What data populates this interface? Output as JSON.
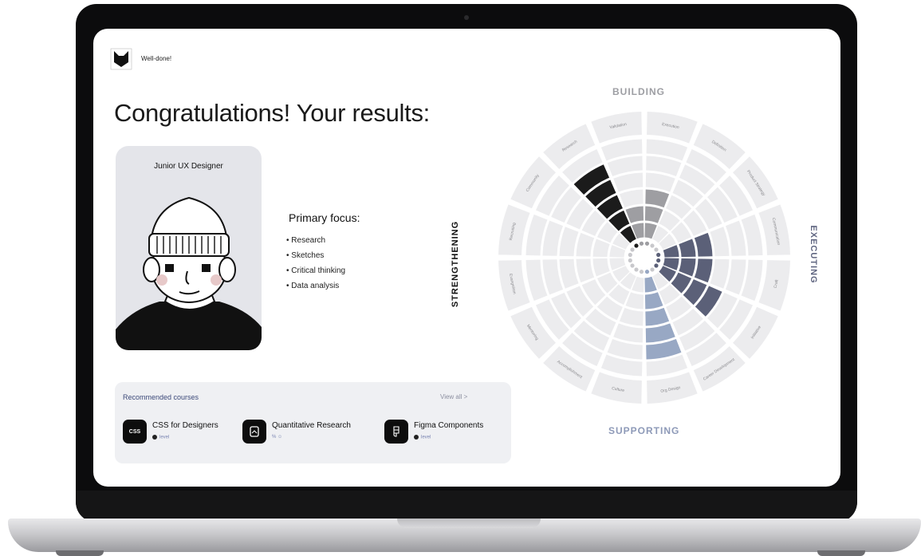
{
  "header": {
    "brand": "Well-done!"
  },
  "page": {
    "title": "Congratulations! Your results:"
  },
  "profile": {
    "role": "Junior UX Designer"
  },
  "focus": {
    "title": "Primary focus:",
    "items": [
      "Research",
      "Sketches",
      "Critical thinking",
      "Data analysis"
    ]
  },
  "courses": {
    "title": "Recommended courses",
    "view_all": "View all >",
    "items": [
      {
        "name": "CSS for Designers",
        "icon": "css-icon",
        "icon_text": "CSS",
        "meta": "level"
      },
      {
        "name": "Quantitative Research",
        "icon": "document-icon",
        "icon_text": "",
        "meta": "% ☺"
      },
      {
        "name": "Figma Components",
        "icon": "figma-icon",
        "icon_text": "",
        "meta": "level"
      }
    ]
  },
  "wheel": {
    "quadrants": {
      "top": "BUILDING",
      "right": "EXECUTING",
      "bottom": "SUPPORTING",
      "left": "STRENGTHENING"
    },
    "categories": [
      "Execution",
      "Definition",
      "Product Strategy",
      "Communication",
      "Craft",
      "Initiative",
      "Career Development",
      "Org Design",
      "Culture",
      "Accomplishment",
      "Mentoring",
      "Evangelism",
      "Recruiting",
      "Community",
      "Research",
      "Validation"
    ],
    "levels": [
      3,
      0,
      0,
      3,
      3,
      4,
      0,
      5,
      0,
      0,
      0,
      0,
      0,
      0,
      5,
      2
    ],
    "max_level": 6,
    "colors": {
      "building": "#9e9ea2",
      "executing": "#5b6078",
      "supporting": "#98a8c4",
      "strengthening": "#1b1b1b",
      "empty": "#ececee"
    }
  }
}
